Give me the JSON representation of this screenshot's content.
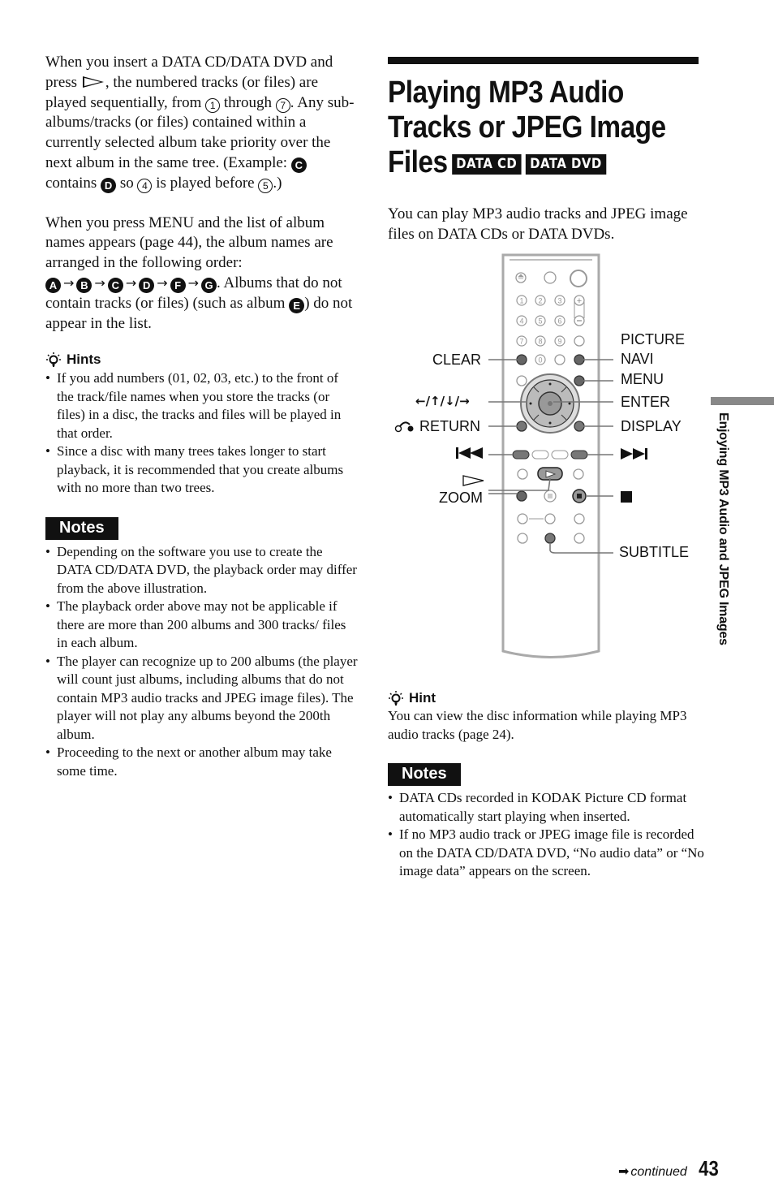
{
  "left": {
    "para1": {
      "t1": "When you insert a DATA CD/DATA DVD and press ",
      "t2": ", the numbered tracks (or files) are played sequentially, from ",
      "c1": "1",
      "t3": " through ",
      "c2": "7",
      "t4": ". Any sub-albums/tracks (or files) contained within a currently selected album take priority over the next album in the same tree. (Example: ",
      "b1": "C",
      "t5": " contains ",
      "b2": "D",
      "t6": " so ",
      "c3": "4",
      "t7": " is played before ",
      "c4": "5",
      "t8": ".)"
    },
    "para2": {
      "t1": "When you press MENU and the list of album names appears (page 44), the album names are arranged in the following order:",
      "order": [
        "A",
        "B",
        "C",
        "D",
        "F",
        "G"
      ],
      "arrow": "→",
      "t2": ". Albums that do not contain tracks (or files) (such as album ",
      "b": "E",
      "t3": ") do not appear in the list."
    },
    "hints": {
      "icon": "lightbulb-icon",
      "title": "Hints",
      "items": [
        "If you add numbers (01, 02, 03, etc.) to the front of the track/file names when you store the tracks (or files) in a disc, the tracks and files will be played in that order.",
        "Since a disc with many trees takes longer to start playback, it is recommended that you create albums with no more than two trees."
      ]
    },
    "notes": {
      "title": "Notes",
      "items": [
        "Depending on the software you use to create the DATA CD/DATA DVD, the playback order may differ from the above illustration.",
        "The playback order above may not be applicable if there are more than 200 albums and 300 tracks/ files in each album.",
        "The player can recognize up to 200 albums (the player will count just albums, including albums that do not contain MP3 audio tracks and JPEG image files). The player will not play any albums beyond the 200th album.",
        "Proceeding to the next or another album may take some time."
      ]
    }
  },
  "right": {
    "title_line1": "Playing MP3 Audio",
    "title_line2": "Tracks or JPEG Image",
    "title_line3": "Files",
    "tags": [
      "DATA CD",
      "DATA DVD"
    ],
    "intro": "You can play MP3 audio tracks and JPEG image files on DATA CDs or DATA DVDs.",
    "figure": {
      "labels_left": {
        "clear": "CLEAR",
        "arrows": "←/↑/↓/→",
        "return": "RETURN",
        "prev": "⏮",
        "play": "▷",
        "zoom": "ZOOM"
      },
      "labels_right": {
        "picture": "PICTURE",
        "navi": "NAVI",
        "menu": "MENU",
        "enter": "ENTER",
        "display": "DISPLAY",
        "next": "⏭",
        "stop": "■",
        "subtitle": "SUBTITLE"
      },
      "keypad": [
        "1",
        "2",
        "3",
        "4",
        "5",
        "6",
        "7",
        "8",
        "9",
        "0"
      ]
    },
    "hint": {
      "icon": "lightbulb-icon",
      "title": "Hint",
      "text": "You can view the disc information while playing MP3 audio tracks (page 24)."
    },
    "notes": {
      "title": "Notes",
      "items": [
        "DATA CDs recorded in KODAK Picture CD format automatically start playing when inserted.",
        "If no MP3 audio track or JPEG image file is recorded on the DATA CD/DATA DVD, “No audio data” or “No image data” appears on the screen."
      ]
    }
  },
  "side_tab": "Enjoying MP3 Audio and JPEG Images",
  "footer": {
    "arrow": "➡",
    "continued": "continued",
    "page_number": "43"
  }
}
